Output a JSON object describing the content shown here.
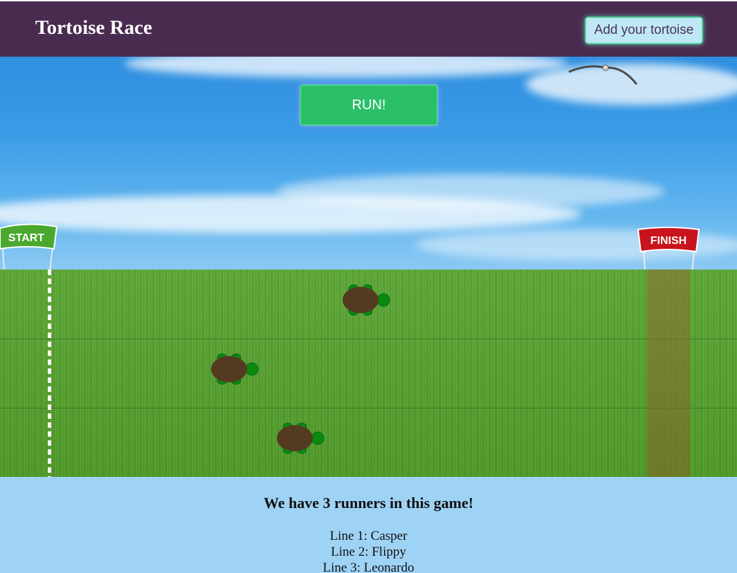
{
  "header": {
    "title": "Tortoise Race",
    "add_button_label": "Add your tortoise"
  },
  "race": {
    "run_button_label": "RUN!",
    "start_flag_text": "START",
    "finish_flag_text": "FINISH",
    "lanes": 3
  },
  "runners_summary": {
    "heading": "We have 3 runners in this game!",
    "runners": [
      {
        "label": "Line 1: Casper",
        "progress": 0.49
      },
      {
        "label": "Line 2: Flippy",
        "progress": 0.27
      },
      {
        "label": "Line 3: Leonardo",
        "progress": 0.38
      }
    ]
  },
  "colors": {
    "header_bg": "#4a2b50",
    "run_button": "#2bbf68",
    "add_button": "#bfe8f7",
    "grass": "#5aa831",
    "turtle_shell": "#553a22",
    "turtle_body": "#0a8a0a",
    "footer_bg": "#9fd3f6",
    "start_flag": "#4aa82e",
    "finish_flag": "#c8141c"
  }
}
